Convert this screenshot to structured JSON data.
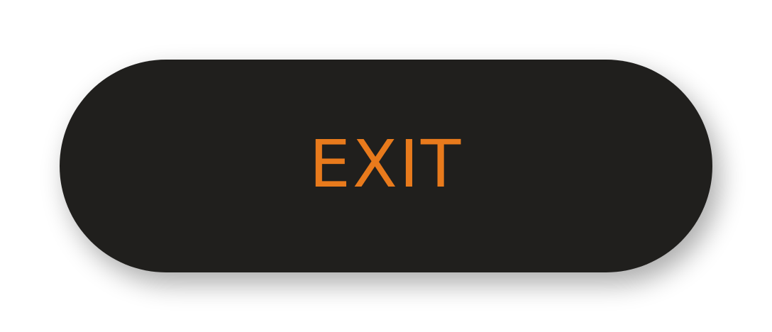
{
  "button": {
    "label": "EXIT"
  },
  "colors": {
    "button_bg": "#201f1d",
    "label": "#e87a1c",
    "page_bg": "#ffffff"
  }
}
